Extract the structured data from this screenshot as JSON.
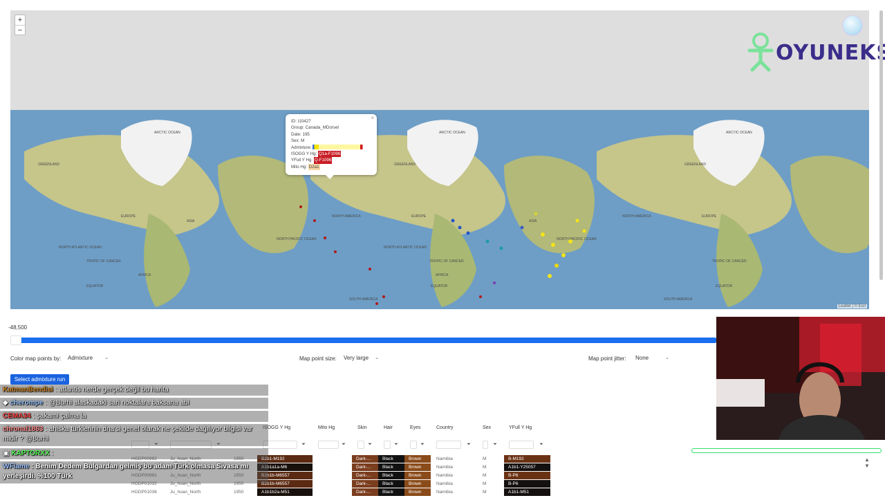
{
  "map": {
    "zoom_in": "+",
    "zoom_out": "−",
    "attribution": "Leaflet | © Esri",
    "labels": [
      {
        "text": "ARCTIC OCEAN"
      },
      {
        "text": "GREENLAND"
      },
      {
        "text": "ARCTIC OCEAN"
      },
      {
        "text": "GREENLAND"
      },
      {
        "text": "ARCTIC OCEAN"
      },
      {
        "text": "GREENLAND"
      },
      {
        "text": "EUROPE"
      },
      {
        "text": "ASIA"
      },
      {
        "text": "NORTH AMERICA"
      },
      {
        "text": "EUROPE"
      },
      {
        "text": "ASIA"
      },
      {
        "text": "NORTH AMERICA"
      },
      {
        "text": "EUROPE"
      },
      {
        "text": "NORTH PACIFIC OCEAN"
      },
      {
        "text": "NORTH PACIFIC OCEAN"
      },
      {
        "text": "NORTH ATLANTIC OCEAN"
      },
      {
        "text": "NORTH ATLANTIC OCEAN"
      },
      {
        "text": "AFRICA"
      },
      {
        "text": "AFRICA"
      },
      {
        "text": "TROPIC OF CANCER"
      },
      {
        "text": "TROPIC OF CANCER"
      },
      {
        "text": "TROPIC OF CANCER"
      },
      {
        "text": "EQUATOR"
      },
      {
        "text": "EQUATOR"
      },
      {
        "text": "EQUATOR"
      },
      {
        "text": "SOUTH AMERICA"
      },
      {
        "text": "SOUTH AMERICA"
      }
    ],
    "popup": {
      "id": "ID: I10427",
      "group": "Group: Canada_MDorset",
      "date": "Date: 195",
      "sex": "Sex: M",
      "admixture_label": "Admixture:",
      "isogg_label": "ISOGG Y Hg:",
      "isogg_value": "Q1a-F1096",
      "yfull_label": "YFull Y Hg:",
      "yfull_value": "Q-F1096",
      "mito_label": "Mito Hg:",
      "mito_value": "D2a1",
      "close": "×"
    }
  },
  "logo": {
    "text": "OYUNEKS"
  },
  "slider": {
    "value": "-48,500"
  },
  "controls": {
    "color_by_label": "Color map points by:",
    "color_by_value": "Admixture",
    "point_size_label": "Map point size:",
    "point_size_value": "Very large",
    "jitter_label": "Map point jitter:",
    "jitter_value": "None",
    "admix_button": "Select admixture run"
  },
  "table": {
    "headers": [
      "ISOGG Y Hg",
      "Mito Hg",
      "Skin",
      "Hair",
      "Eyes",
      "Country",
      "Sex",
      "YFull Y Hg"
    ],
    "rows": [
      {
        "id": "HGDP00992",
        "group": "Ju_hoan_North",
        "date": "1950",
        "isogg": "B2b1-M192",
        "skin": "Dark-...",
        "hair": "Black",
        "eyes": "Brown",
        "country": "Namibia",
        "sex": "M",
        "yfull": "B-M192"
      },
      {
        "id": "HGDP00987",
        "group": "Ju_hoan_North",
        "date": "1950",
        "isogg": "A1b1a1a-M6",
        "skin": "Dark-...",
        "hair": "Black",
        "eyes": "Brown",
        "country": "Namibia",
        "sex": "M",
        "yfull": "A1b1-Y25057"
      },
      {
        "id": "HGDP00991",
        "group": "Ju_hoan_North",
        "date": "1950",
        "isogg": "B2b1b-M6557",
        "skin": "Dark-...",
        "hair": "Black",
        "eyes": "Brown",
        "country": "Namibia",
        "sex": "M",
        "yfull": "B-P6"
      },
      {
        "id": "HGDP01032",
        "group": "Ju_hoan_North",
        "date": "1950",
        "isogg": "B2b1b-M6557",
        "skin": "Dark-...",
        "hair": "Black",
        "eyes": "Brown",
        "country": "Namibia",
        "sex": "M",
        "yfull": "B-P6"
      },
      {
        "id": "HGDP01036",
        "group": "Ju_hoan_North",
        "date": "1950",
        "isogg": "A1b1b2a-M51",
        "skin": "Dark-...",
        "hair": "Black",
        "eyes": "Brown",
        "country": "Namibia",
        "sex": "M",
        "yfull": "A1b1-M51"
      }
    ]
  },
  "chat": [
    {
      "user": "KatmanBendisi",
      "user_color": "#d18a2a",
      "text": ": atlantis nerde gerçek değil bu harita"
    },
    {
      "user": "cherompe",
      "user_color": "#9ac8ff",
      "text": ": @Burhi alaskadaki sari noktalara baksana abi"
    },
    {
      "user": "CEMA34",
      "user_color": "#ff4a4a",
      "text": ": şakami çalma la"
    },
    {
      "user": "chronal1863",
      "user_color": "#ff8a8a",
      "text": ": ahiska türklerinin dna'si genel olarak ne şekilde dağılıyor bilgisi var midir ? @Burhi"
    },
    {
      "user": "KAPTORXX",
      "user_color": "#5dff5d",
      "text": ":"
    },
    {
      "user": "WFlame",
      "user_color": "#9fc3ff",
      "text": ": Benim Dedem Bulgardan gelmiş bu adam Türk olmasa Sivasa mı yerleşirdi. %100 Türk"
    }
  ]
}
